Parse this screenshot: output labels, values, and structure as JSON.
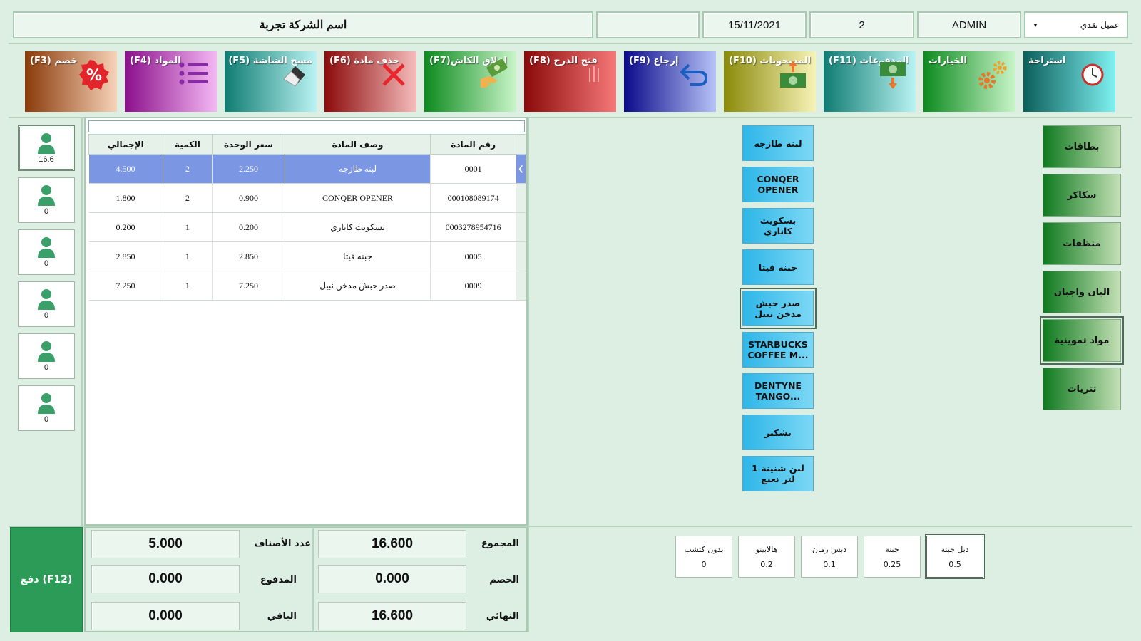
{
  "header": {
    "company": "اسم الشركة تجربة",
    "empty_field": "",
    "date": "15/11/2021",
    "counter": "2",
    "user": "ADMIN",
    "customer_select": "عميل نقدي"
  },
  "function_buttons": [
    {
      "label": "خصم (F3)",
      "icon": "percent-icon"
    },
    {
      "label": "المواد (F4)",
      "icon": "list-icon"
    },
    {
      "label": "مسح الشاشة (F5)",
      "icon": "eraser-icon"
    },
    {
      "label": "حذف مادة (F6)",
      "icon": "x-icon"
    },
    {
      "label": "إغلاق الكاش(F7)",
      "icon": "cash-hand-icon"
    },
    {
      "label": "فتح الدرج (F8)",
      "icon": "drawer-icon"
    },
    {
      "label": "إرجاع (F9)",
      "icon": "return-icon"
    },
    {
      "label": "المسحوبات (F10)",
      "icon": "cash-out-icon"
    },
    {
      "label": "المدفوعات (F11)",
      "icon": "cash-in-icon"
    },
    {
      "label": "الخيارات",
      "icon": "gears-icon"
    },
    {
      "label": "استراحة",
      "icon": "clock-icon"
    }
  ],
  "customers": [
    {
      "value": "16.6"
    },
    {
      "value": "0"
    },
    {
      "value": "0"
    },
    {
      "value": "0"
    },
    {
      "value": "0"
    },
    {
      "value": "0"
    }
  ],
  "grid": {
    "search_value": "",
    "columns": [
      "الإجمالي",
      "الكمية",
      "سعر الوحدة",
      "وصف المادة",
      "رقم المادة"
    ],
    "rows": [
      {
        "total": "4.500",
        "qty": "2",
        "price": "2.250",
        "desc": "لبنه طازجه",
        "code": "0001"
      },
      {
        "total": "1.800",
        "qty": "2",
        "price": "0.900",
        "desc": "CONQER OPENER",
        "code": "000108089174"
      },
      {
        "total": "0.200",
        "qty": "1",
        "price": "0.200",
        "desc": "بسكويت كاناري",
        "code": "0003278954716"
      },
      {
        "total": "2.850",
        "qty": "1",
        "price": "2.850",
        "desc": "جبنه فيتا",
        "code": "0005"
      },
      {
        "total": "7.250",
        "qty": "1",
        "price": "7.250",
        "desc": "صدر حبش مدخن نبيل",
        "code": "0009"
      }
    ]
  },
  "products": [
    "لبنه طازجه",
    "CONQER OPENER",
    "بسكويت كاناري",
    "جبنه فيتا",
    "صدر حبش مدخن نبيل",
    "STARBUCKS COFFEE M...",
    "DENTYNE TANGO...",
    "بشكير",
    "لبن شنينة 1 لتر نعنع"
  ],
  "categories": [
    "بطاقات",
    "سكاكر",
    "منظفات",
    "البان واجبان",
    "مواد تموينية",
    "تتريات"
  ],
  "pay_button": "دفع (F12)",
  "totals": {
    "items_count_label": "عدد الأصناف",
    "items_count": "5.000",
    "paid_label": "المدفوع",
    "paid": "0.000",
    "remaining_label": "الباقي",
    "remaining": "0.000",
    "sum_label": "المجموع",
    "sum": "16.600",
    "discount_label": "الخصم",
    "discount": "0.000",
    "final_label": "النهائي",
    "final": "16.600"
  },
  "addons": [
    {
      "name": "بدون كتشب",
      "price": "0"
    },
    {
      "name": "هالابينو",
      "price": "0.2"
    },
    {
      "name": "دبس رمان",
      "price": "0.1"
    },
    {
      "name": "جبنة",
      "price": "0.25"
    },
    {
      "name": "دبل جبنة",
      "price": "0.5"
    }
  ],
  "colors": {
    "background": "#dcefe2",
    "selected_row": "#7b96e3",
    "pay_button": "#2d9b58",
    "product_button": "#2eb6e8"
  }
}
